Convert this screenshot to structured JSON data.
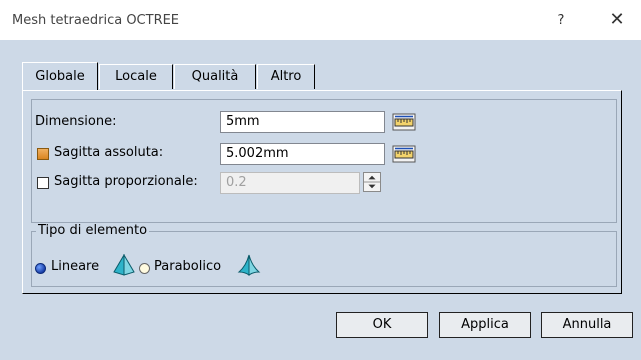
{
  "window": {
    "title": "Mesh tetraedrica OCTREE",
    "help": "?",
    "close": "✕"
  },
  "tabs": [
    {
      "label": "Globale",
      "active": true
    },
    {
      "label": "Locale",
      "active": false
    },
    {
      "label": "Qualità",
      "active": false
    },
    {
      "label": "Altro",
      "active": false
    }
  ],
  "dimensione": {
    "label": "Dimensione:",
    "value": "5mm"
  },
  "sagitta_assoluta": {
    "label": "Sagitta assoluta:",
    "value": "5.002mm",
    "checked": true
  },
  "sagitta_proporzionale": {
    "label": "Sagitta proporzionale:",
    "value": "0.2",
    "checked": false,
    "enabled": false
  },
  "tipo_elemento": {
    "title": "Tipo di elemento",
    "options": [
      {
        "label": "Lineare",
        "selected": true
      },
      {
        "label": "Parabolico",
        "selected": false
      }
    ]
  },
  "buttons": {
    "ok": "OK",
    "apply": "Applica",
    "cancel": "Annulla"
  },
  "icons": {
    "ruler": "ruler-icon",
    "linear_tet": "linear-tetrahedron-icon",
    "parabolic_tet": "parabolic-tetrahedron-icon"
  },
  "colors": {
    "dialog_bg": "#cdd9e7",
    "accent_check": "#d98520"
  }
}
